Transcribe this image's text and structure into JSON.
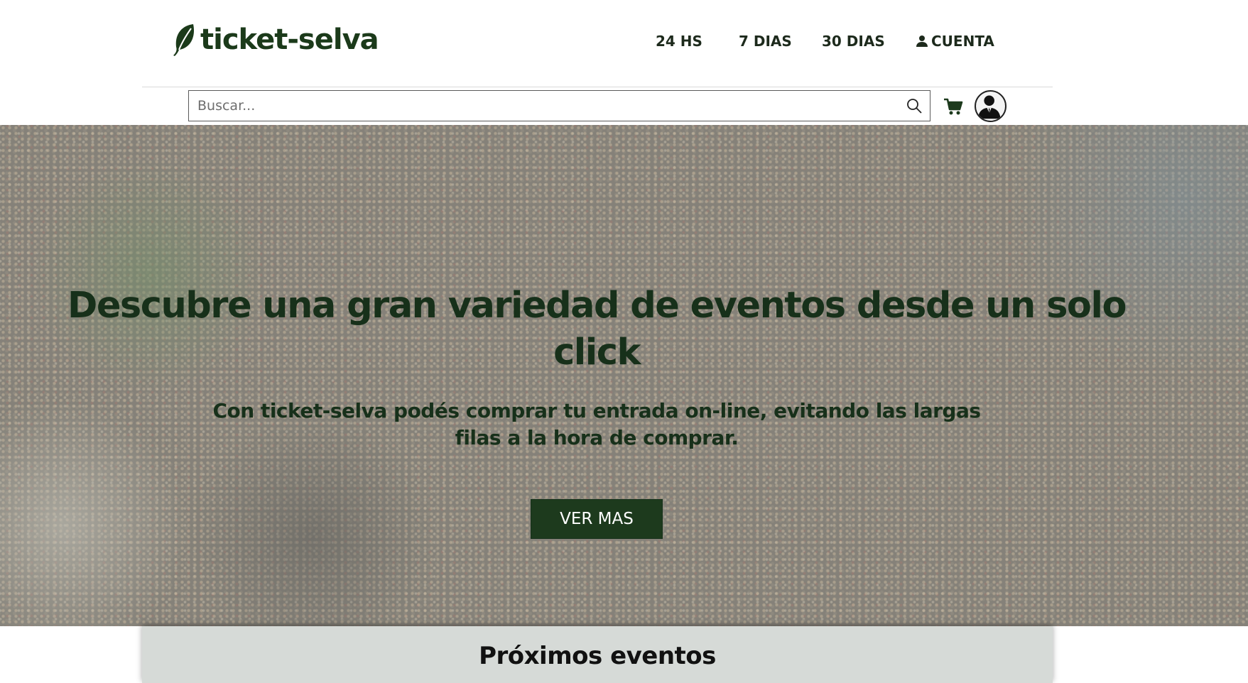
{
  "brand": {
    "name": "ticket-selva",
    "logo_icon": "leaf-icon",
    "color": "#1b3a1a"
  },
  "nav": {
    "items": [
      {
        "label": "24 HS"
      },
      {
        "label": "7 DIAS"
      },
      {
        "label": "30 DIAS"
      },
      {
        "label": "CUENTA",
        "icon": "user-icon"
      }
    ]
  },
  "search": {
    "placeholder": "Buscar...",
    "value": "",
    "icon": "search-icon"
  },
  "toolbar": {
    "cart_icon": "cart-icon",
    "avatar_icon": "avatar-icon"
  },
  "hero": {
    "title": "Descubre una gran variedad de eventos desde un solo click",
    "subtitle": "Con ticket-selva podés comprar tu entrada on-line, evitando las largas filas a la hora de comprar.",
    "button_label": "VER MAS",
    "button_color": "#1d3a1d"
  },
  "events": {
    "title": "Próximos eventos"
  }
}
